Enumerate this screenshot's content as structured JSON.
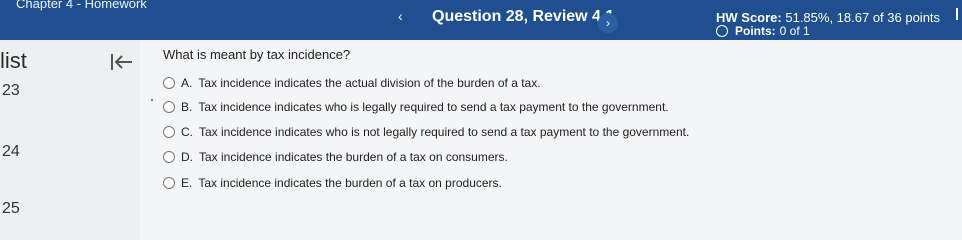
{
  "header": {
    "chapter_title": "Chapter 4 - Homework",
    "question_title": "Question 28, Review 4.1",
    "prev_icon": "chevron-left-icon",
    "next_icon": "chevron-right-icon",
    "hw_score_label": "HW Score:",
    "hw_score_value": "51.85%, 18.67 of 36 points",
    "points_label": "Points:",
    "points_value": "0 of 1"
  },
  "sidebar": {
    "label": "list",
    "collapse_icon": "collapse-left-icon",
    "questions": [
      "23",
      "24",
      "25"
    ]
  },
  "question": {
    "prompt": "What is meant by tax incidence?",
    "choices": [
      {
        "letter": "A.",
        "text": "Tax incidence indicates the actual division of the burden of a tax."
      },
      {
        "letter": "B.",
        "text": "Tax incidence indicates who is legally required to send a tax payment to the government."
      },
      {
        "letter": "C.",
        "text": "Tax incidence indicates who is not legally required to send a tax payment to the government."
      },
      {
        "letter": "D.",
        "text": "Tax incidence indicates the burden of a tax on consumers."
      },
      {
        "letter": "E.",
        "text": "Tax incidence indicates the burden of a tax on producers."
      }
    ]
  },
  "colors": {
    "header_bg": "#1f4f8e",
    "content_bg": "#f4f5f6"
  }
}
